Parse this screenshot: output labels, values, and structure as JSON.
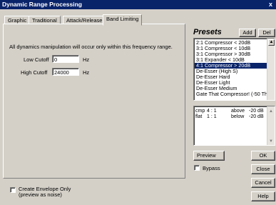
{
  "window": {
    "title": "Dynamic Range Processing",
    "close_glyph": "x"
  },
  "tabs": [
    {
      "label": "Graphic"
    },
    {
      "label": "Traditional"
    },
    {
      "label": "Attack/Release"
    },
    {
      "label": "Band Limiting"
    }
  ],
  "band_limiting": {
    "note": "All dynamics manipulation will occur only within this frequency range.",
    "low_cutoff_label": "Low Cutoff",
    "low_cutoff_value": "0",
    "low_cutoff_unit": "Hz",
    "high_cutoff_label": "High Cutoff",
    "high_cutoff_value": "24000",
    "high_cutoff_unit": "Hz"
  },
  "presets": {
    "title": "Presets",
    "add_label": "Add",
    "del_label": "Del",
    "items": [
      "2:1 Compressor < 20dB",
      "3:1 Compressor < 10dB",
      "3:1 Compressor > 30dB",
      "3:1 Expander < 10dB",
      "4:1 Compressor > 20dB",
      "De-Esser (High S)",
      "De-Esser Hard",
      "De-Esser Light",
      "De-Esser Medium",
      "Gate That Compressor! (-50 Thr"
    ],
    "selected_index": 4
  },
  "summary": {
    "rows": [
      {
        "c1": "cmp",
        "c2": "4 : 1",
        "c3": "above",
        "c4": "-20 dB"
      },
      {
        "c1": "flat",
        "c2": "1 : 1",
        "c3": "below",
        "c4": "-20 dB"
      }
    ]
  },
  "buttons": {
    "preview": "Preview",
    "ok": "OK",
    "close": "Close",
    "cancel": "Cancel",
    "help": "Help"
  },
  "bypass_label": "Bypass",
  "envelope": {
    "label": "Create Envelope Only",
    "sublabel": "(preview as noise)"
  }
}
